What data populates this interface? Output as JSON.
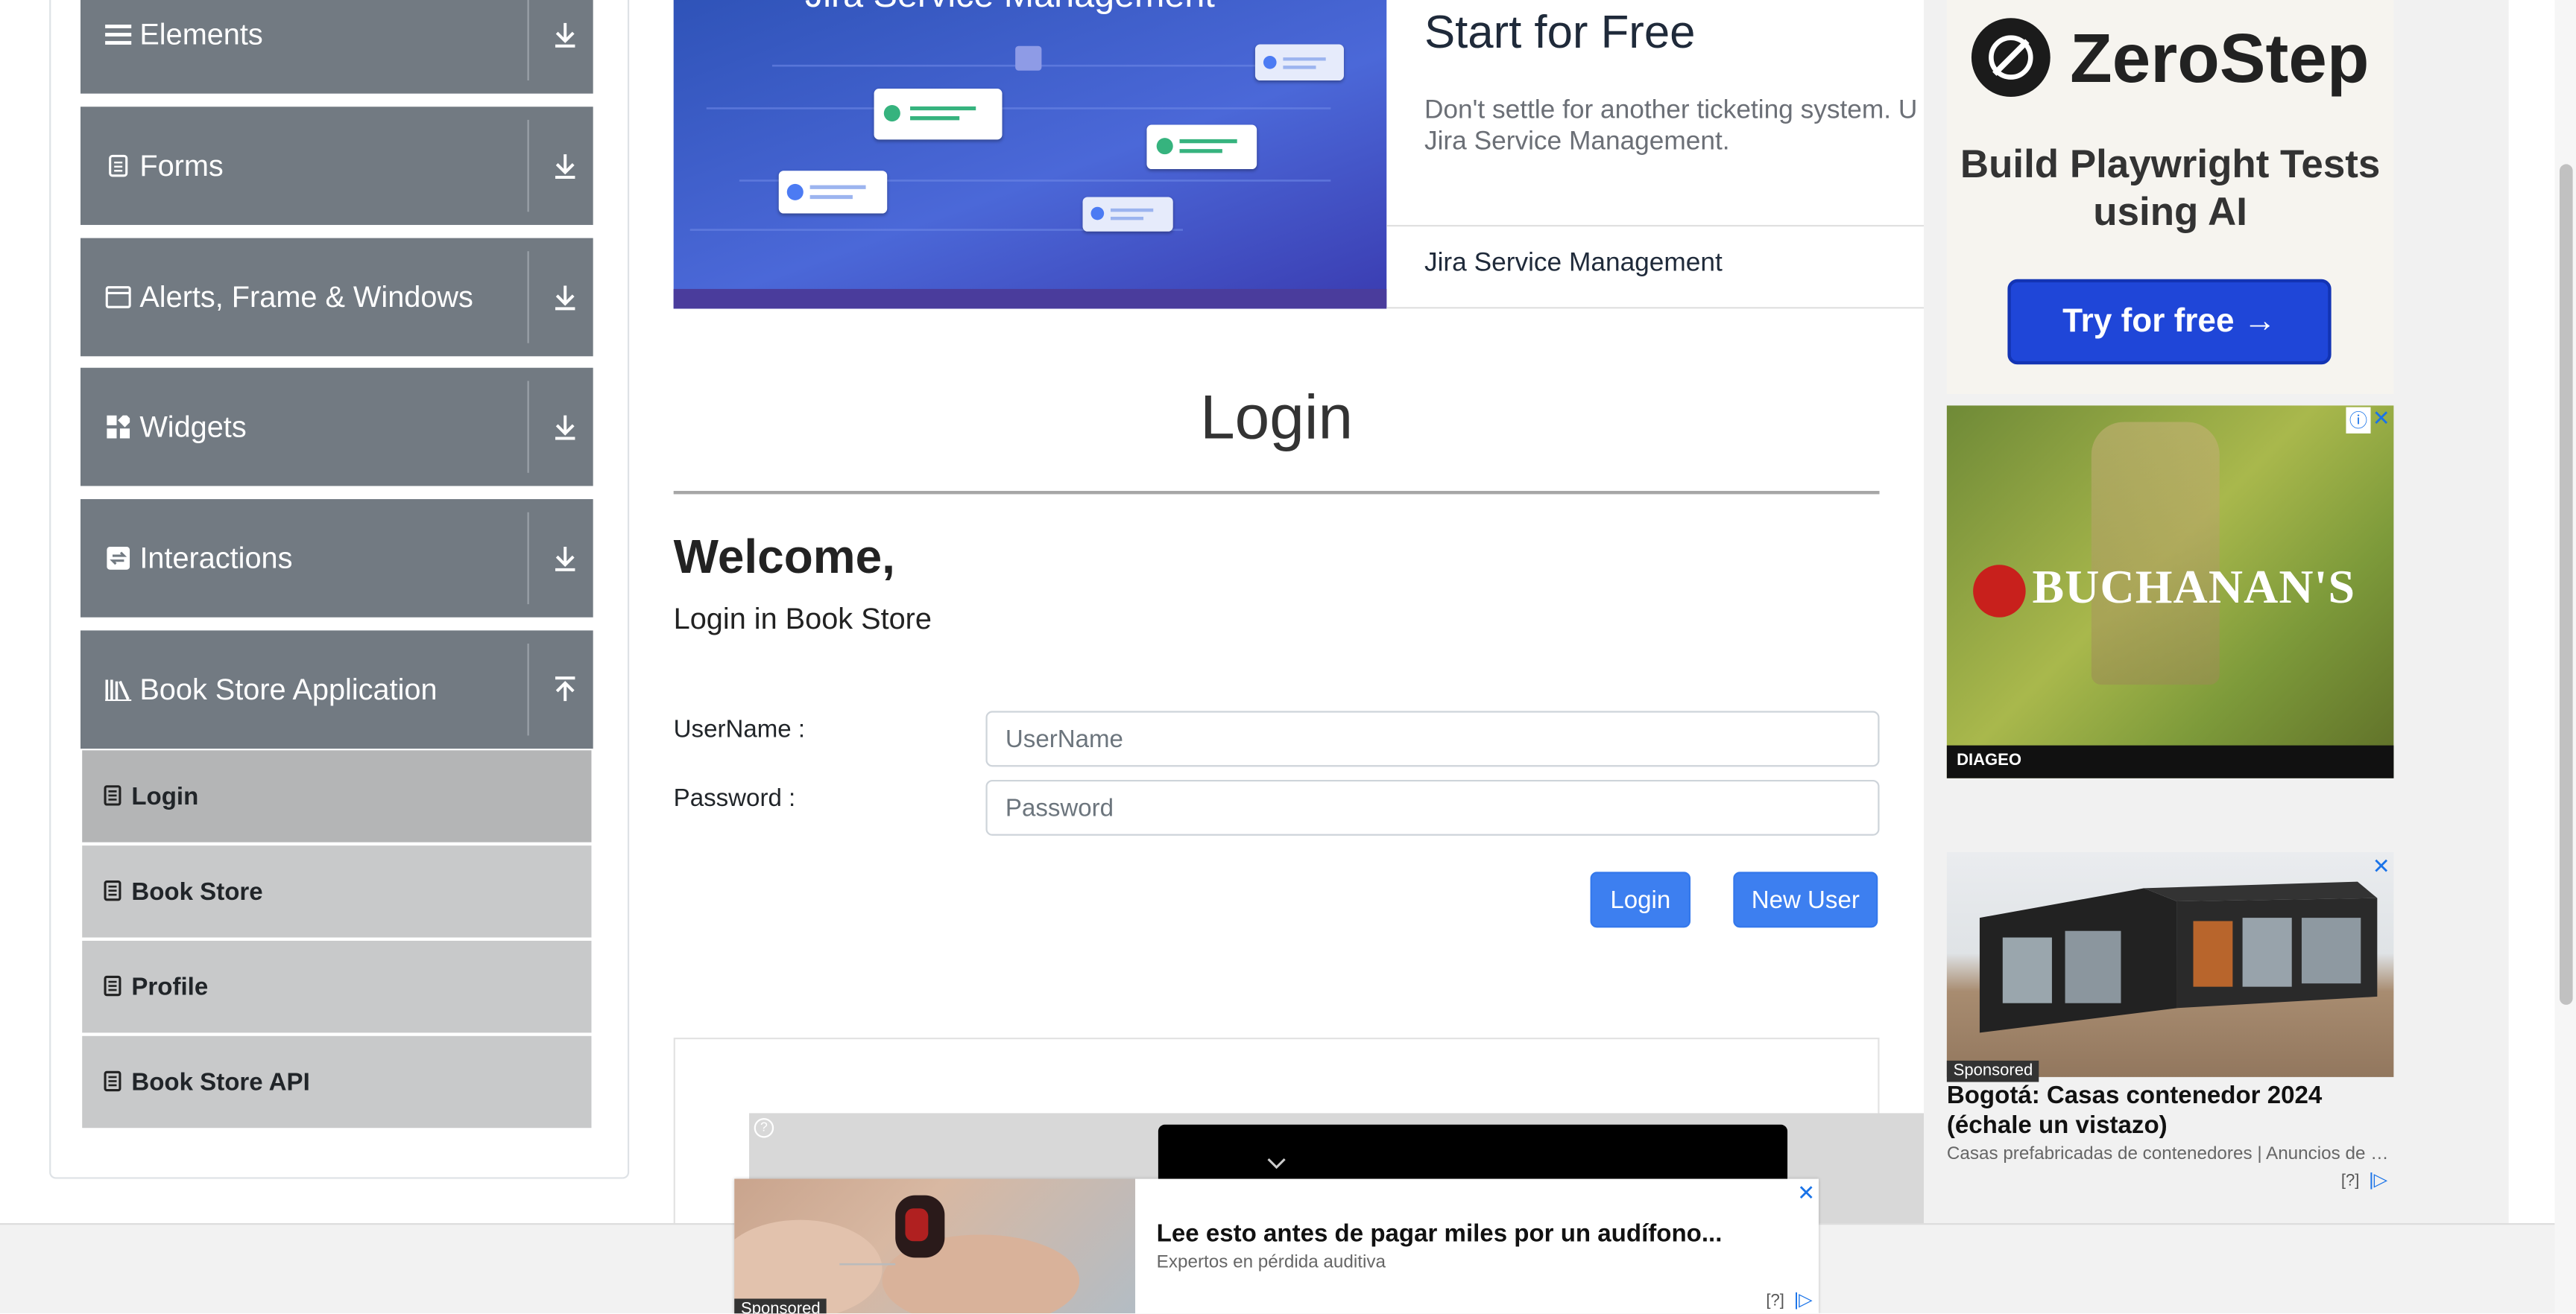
{
  "sidebar": {
    "groups": [
      {
        "label": "Elements",
        "icon": "hamburger-icon",
        "toggle": "expand-icon"
      },
      {
        "label": "Forms",
        "icon": "document-icon",
        "toggle": "expand-icon"
      },
      {
        "label": "Alerts, Frame & Windows",
        "icon": "window-icon",
        "toggle": "expand-icon"
      },
      {
        "label": "Widgets",
        "icon": "widgets-icon",
        "toggle": "expand-icon"
      },
      {
        "label": "Interactions",
        "icon": "interactions-icon",
        "toggle": "expand-icon"
      },
      {
        "label": "Book Store Application",
        "icon": "books-icon",
        "toggle": "collapse-icon"
      }
    ],
    "book_store_items": [
      {
        "label": "Login",
        "active": true
      },
      {
        "label": "Book Store",
        "active": false
      },
      {
        "label": "Profile",
        "active": false
      },
      {
        "label": "Book Store API",
        "active": false
      }
    ]
  },
  "top_ad": {
    "image_caption": "Jira Service Management",
    "title": "Start for Free",
    "body": "Don't settle for another ticketing system. U Jira Service Management.",
    "footer": "Jira Service Management"
  },
  "login": {
    "title": "Login",
    "welcome": "Welcome,",
    "subtitle": "Login in Book Store",
    "username_label": "UserName :",
    "username_placeholder": "UserName",
    "password_label": "Password :",
    "password_placeholder": "Password",
    "login_button": "Login",
    "new_user_button": "New User"
  },
  "right_ads": {
    "zerostep": {
      "brand": "ZeroStep",
      "tagline": "Build Playwright Tests using AI",
      "cta": "Try for free →"
    },
    "whisky": {
      "brand": "BUCHANAN'S",
      "footer": "DIAGEO"
    },
    "houses": {
      "badge": "Sponsored",
      "title": "Bogotá: Casas contenedor 2024 (échale un vistazo)",
      "subtitle": "Casas prefabricadas de contenedores | Anuncios de b...",
      "help": "[?]"
    }
  },
  "bottom_ad": {
    "badge": "Sponsored",
    "headline": "Lee esto antes de pagar miles por un audífono...",
    "source": "Expertos en pérdida auditiva",
    "help": "[?]"
  },
  "colors": {
    "sidebar_group": "#727a82",
    "sidebar_sub": "#c8c9ca",
    "primary_button": "#3d7ff0",
    "zerostep_button": "#1f46d8"
  }
}
